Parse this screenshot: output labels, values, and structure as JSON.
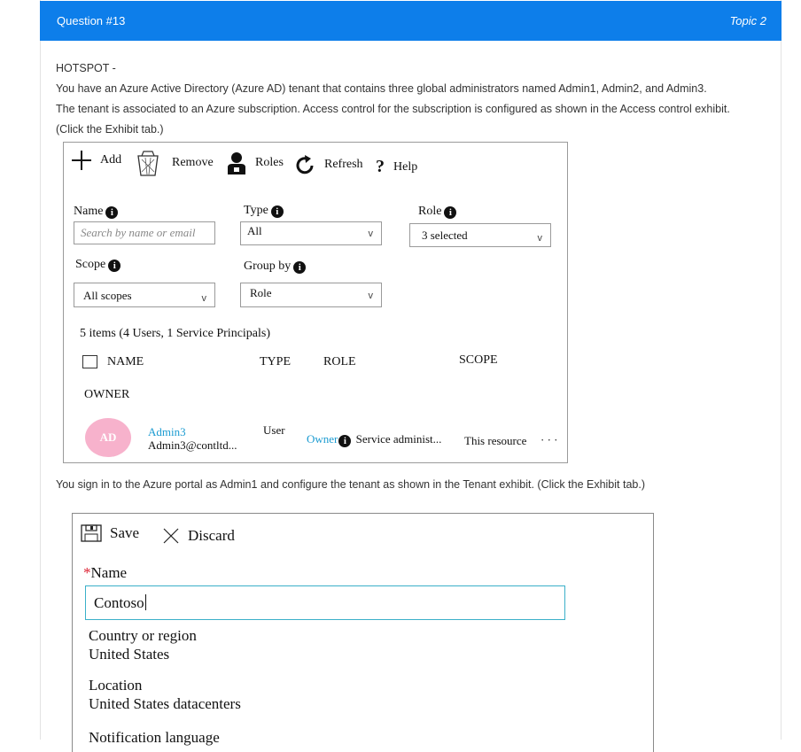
{
  "header": {
    "question": "Question #13",
    "topic": "Topic 2"
  },
  "question_text": {
    "tag": "HOTSPOT -",
    "line1": "You have an Azure Active Directory (Azure AD) tenant that contains three global administrators named Admin1, Admin2, and Admin3.",
    "line2": "The tenant is associated to an Azure subscription. Access control for the subscription is configured as shown in the Access control exhibit.",
    "line3": "(Click the Exhibit tab.)"
  },
  "access_control": {
    "toolbar": {
      "add": "Add",
      "remove": "Remove",
      "roles": "Roles",
      "refresh": "Refresh",
      "help": "Help"
    },
    "filters": {
      "name_label": "Name",
      "name_placeholder": "Search by name or email",
      "type_label": "Type",
      "type_value": "All",
      "role_label": "Role",
      "role_value": "3 selected",
      "scope_label": "Scope",
      "scope_value": "All scopes",
      "groupby_label": "Group by",
      "groupby_value": "Role"
    },
    "summary": "5 items (4 Users, 1 Service Principals)",
    "columns": {
      "name": "NAME",
      "type": "TYPE",
      "role": "ROLE",
      "scope": "SCOPE"
    },
    "group_heading": "OWNER",
    "row": {
      "avatar": "AD",
      "name": "Admin3",
      "email": "Admin3@contltd...",
      "type": "User",
      "role": "Owner",
      "role_detail": "Service administ...",
      "scope": "This resource",
      "more": "· · ·"
    }
  },
  "mid_text": "You sign in to the Azure portal as Admin1 and configure the tenant as shown in the Tenant exhibit. (Click the Exhibit tab.)",
  "tenant": {
    "save": "Save",
    "discard": "Discard",
    "required_mark": "*",
    "name_label": "Name",
    "name_value": "Contoso",
    "country_label": "Country or region",
    "country_value": "United States",
    "location_label": "Location",
    "location_value": "United States datacenters",
    "notification_label": "Notification language"
  }
}
